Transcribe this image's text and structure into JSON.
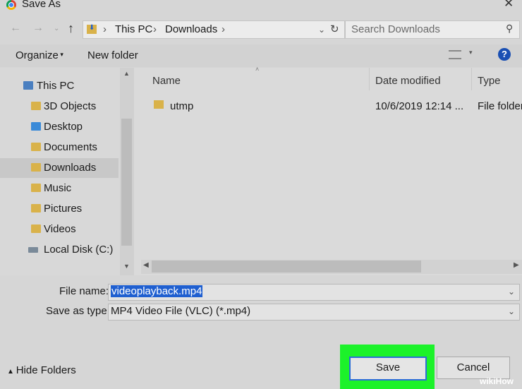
{
  "window": {
    "title": "Save As"
  },
  "nav": {
    "back": "←",
    "forward": "→",
    "up": "↑",
    "path": [
      "This PC",
      "Downloads"
    ],
    "search_placeholder": "Search Downloads"
  },
  "toolbar": {
    "organize": "Organize",
    "new_folder": "New folder"
  },
  "sidebar": {
    "items": [
      {
        "label": "This PC",
        "icon": "pc-icon"
      },
      {
        "label": "3D Objects",
        "icon": "3d-objects-icon"
      },
      {
        "label": "Desktop",
        "icon": "desktop-icon"
      },
      {
        "label": "Documents",
        "icon": "documents-icon"
      },
      {
        "label": "Downloads",
        "icon": "downloads-icon",
        "selected": true
      },
      {
        "label": "Music",
        "icon": "music-icon"
      },
      {
        "label": "Pictures",
        "icon": "pictures-icon"
      },
      {
        "label": "Videos",
        "icon": "videos-icon"
      },
      {
        "label": "Local Disk (C:)",
        "icon": "disk-icon"
      }
    ]
  },
  "files": {
    "columns": [
      "Name",
      "Date modified",
      "Type"
    ],
    "rows": [
      {
        "name": "utmp",
        "date": "10/6/2019 12:14 ...",
        "type": "File folder"
      }
    ]
  },
  "form": {
    "file_name_label": "File name:",
    "file_name_value": "videoplayback.mp4",
    "type_label": "Save as type:",
    "type_value": "MP4 Video File (VLC) (*.mp4)"
  },
  "footer": {
    "hide_folders": "Hide Folders",
    "save": "Save",
    "cancel": "Cancel"
  },
  "watermark": "wikiHow",
  "colors": {
    "highlight": "#1cf22a",
    "accent": "#1f5fd0"
  }
}
